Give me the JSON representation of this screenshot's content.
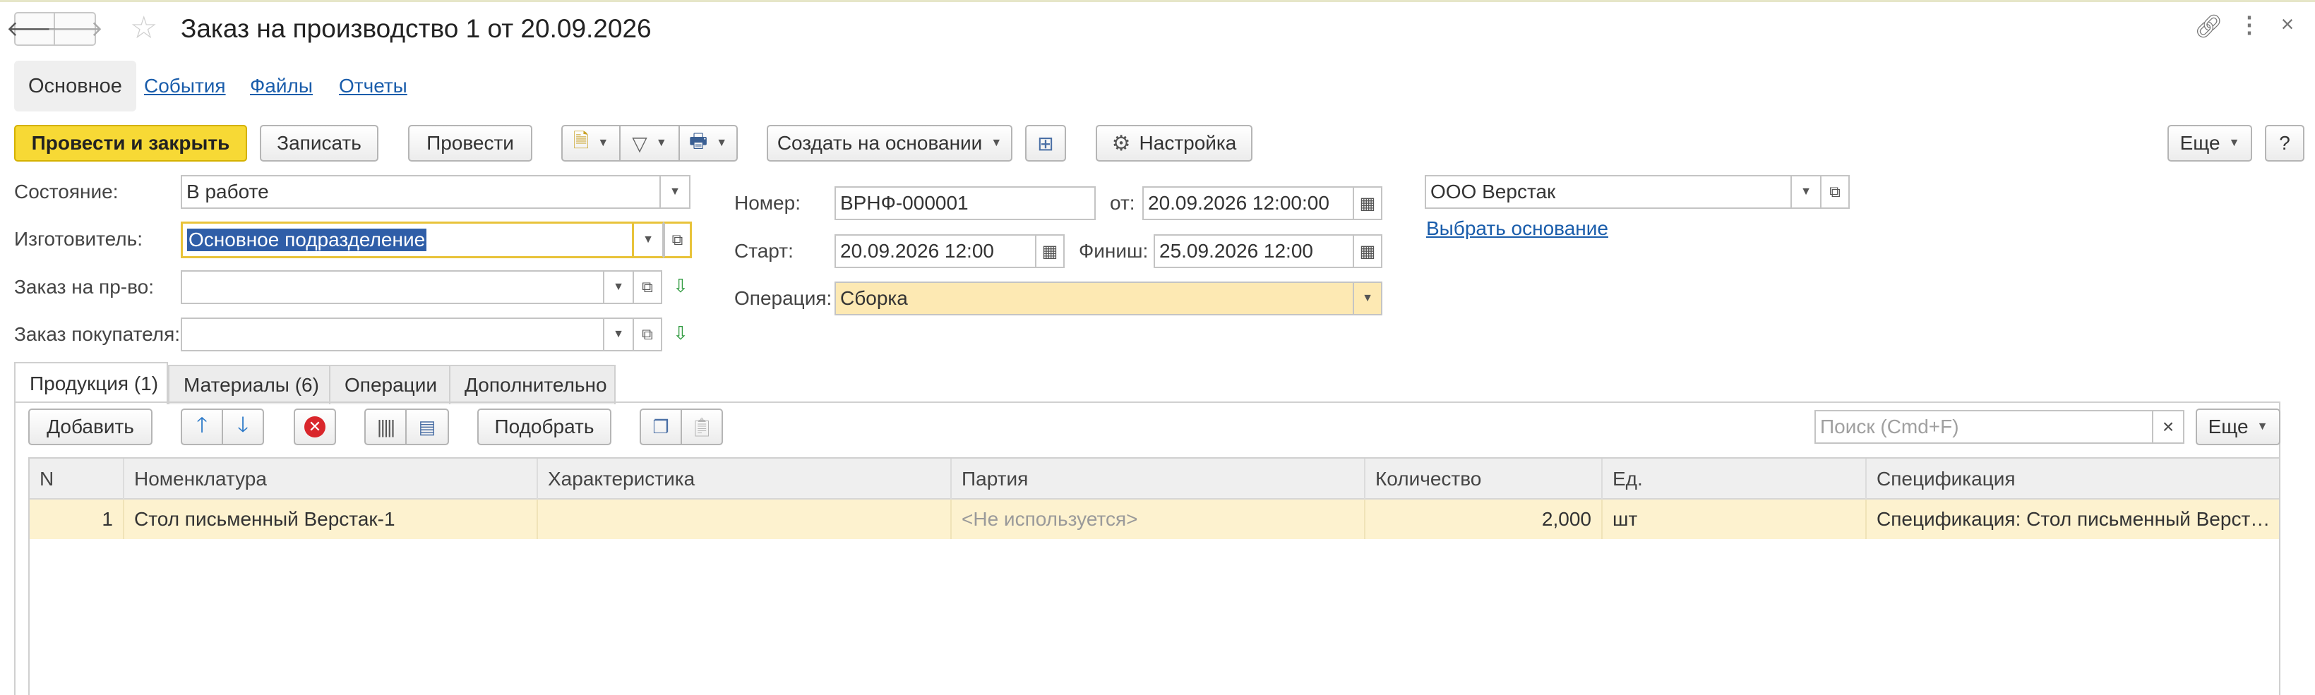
{
  "window": {
    "title": "Заказ на производство 1 от 20.09.2026"
  },
  "icons": {
    "back": "arrow-left-icon",
    "forward": "arrow-right-icon",
    "favorite": "star-icon",
    "link": "link-icon",
    "more": "vertical-dots-icon",
    "close": "close-icon"
  },
  "section_tabs": [
    {
      "label": "Основное",
      "active": true
    },
    {
      "label": "События",
      "active": false
    },
    {
      "label": "Файлы",
      "active": false
    },
    {
      "label": "Отчеты",
      "active": false
    }
  ],
  "toolbar": {
    "post_close": "Провести и закрыть",
    "save": "Записать",
    "post": "Провести",
    "create_based": "Создать на основании",
    "settings": "Настройка",
    "more": "Еще",
    "help": "?"
  },
  "form": {
    "state_label": "Состояние:",
    "state_value": "В работе",
    "maker_label": "Изготовитель:",
    "maker_value": "Основное подразделение",
    "prod_order_label": "Заказ на пр-во:",
    "prod_order_value": "",
    "customer_order_label": "Заказ покупателя:",
    "customer_order_value": "",
    "number_label": "Номер:",
    "number_value": "ВРНФ-000001",
    "from_label": "от:",
    "from_value": "20.09.2026 12:00:00",
    "start_label": "Старт:",
    "start_value": "20.09.2026 12:00",
    "finish_label": "Финиш:",
    "finish_value": "25.09.2026 12:00",
    "operation_label": "Операция:",
    "operation_value": "Сборка",
    "org_value": "ООО Верстак",
    "choose_base_link": "Выбрать основание"
  },
  "page_tabs": [
    {
      "label": "Продукция (1)",
      "active": true
    },
    {
      "label": "Материалы (6)",
      "active": false
    },
    {
      "label": "Операции",
      "active": false
    },
    {
      "label": "Дополнительно",
      "active": false
    }
  ],
  "table_toolbar": {
    "add": "Добавить",
    "pick": "Подобрать",
    "search_placeholder": "Поиск (Cmd+F)",
    "clear": "×",
    "more": "Еще"
  },
  "table": {
    "columns": [
      "N",
      "Номенклатура",
      "Характеристика",
      "Партия",
      "Количество",
      "Ед.",
      "Спецификация"
    ],
    "rows": [
      [
        "1",
        "Стол письменный Верстак-1",
        "",
        "<Не используется>",
        "2,000",
        "шт",
        "Спецификация: Стол письменный Верст…"
      ]
    ]
  },
  "colors": {
    "primary_button": "#f7d935",
    "highlight_field": "#fde9b3",
    "selected_row": "#fdf2cf",
    "link": "#1a5dab",
    "selection": "#2f5ea8"
  }
}
